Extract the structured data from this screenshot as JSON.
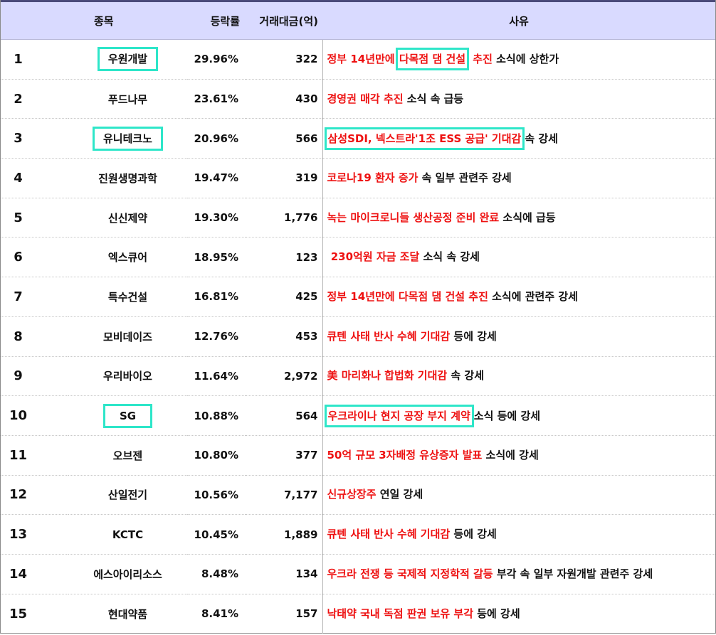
{
  "header": {
    "rank": "",
    "name": "종목",
    "rate": "등락률",
    "volume": "거래대금(억)",
    "reason": "사유"
  },
  "rows": [
    {
      "rank": "1",
      "name": "우원개발",
      "rate": "29.96%",
      "volume": "322",
      "reason": {
        "pre": "",
        "boxed": "",
        "hl": "정부 14년만에 다목점 댐 건설 추진",
        "plain": " 소식에 상한가"
      }
    },
    {
      "rank": "2",
      "name": "푸드나무",
      "rate": "23.61%",
      "volume": "430",
      "reason": {
        "hl": "경영권 매각 추진",
        "plain": " 소식 속 급등"
      }
    },
    {
      "rank": "3",
      "name": "유니테크노",
      "rate": "20.96%",
      "volume": "566",
      "reason": {
        "hl": "삼성SDI, 넥스트라'1조 ESS 공급' 기대감",
        "plain": "속 강세"
      }
    },
    {
      "rank": "4",
      "name": "진원생명과학",
      "rate": "19.47%",
      "volume": "319",
      "reason": {
        "hl": "코로나19 환자 증가",
        "plain": " 속 일부 관련주 강세"
      }
    },
    {
      "rank": "5",
      "name": "신신제약",
      "rate": "19.30%",
      "volume": "1,776",
      "reason": {
        "hl": "녹는 마이크로니들 생산공정 준비 완료",
        "plain": " 소식에 급등"
      }
    },
    {
      "rank": "6",
      "name": "엑스큐어",
      "rate": "18.95%",
      "volume": "123",
      "reason": {
        "hl": " 230억원 자금 조달",
        "plain": " 소식 속 강세"
      }
    },
    {
      "rank": "7",
      "name": "특수건설",
      "rate": "16.81%",
      "volume": "425",
      "reason": {
        "hl": "정부 14년만에 다목점 댐 건설 추진",
        "plain": " 소식에 관련주 강세"
      }
    },
    {
      "rank": "8",
      "name": "모비데이즈",
      "rate": "12.76%",
      "volume": "453",
      "reason": {
        "hl": "큐텐 사태 반사 수혜 기대감",
        "plain": " 등에 강세"
      }
    },
    {
      "rank": "9",
      "name": "우리바이오",
      "rate": "11.64%",
      "volume": "2,972",
      "reason": {
        "hl": "美 마리화나 합법화 기대감",
        "plain": " 속 강세"
      }
    },
    {
      "rank": "10",
      "name": "SG",
      "rate": "10.88%",
      "volume": "564",
      "reason": {
        "hl": "우크라이나 현지 공장 부지 계약",
        "plain": "소식 등에 강세"
      }
    },
    {
      "rank": "11",
      "name": "오브젠",
      "rate": "10.80%",
      "volume": "377",
      "reason": {
        "hl": "50억 규모 3자배정 유상증자 발표",
        "plain": " 소식에 강세"
      }
    },
    {
      "rank": "12",
      "name": "산일전기",
      "rate": "10.56%",
      "volume": "7,177",
      "reason": {
        "hl": "신규상장주",
        "plain": " 연일 강세"
      }
    },
    {
      "rank": "13",
      "name": "KCTC",
      "rate": "10.45%",
      "volume": "1,889",
      "reason": {
        "hl": "큐텐 사태 반사 수혜 기대감",
        "plain": " 등에 강세"
      }
    },
    {
      "rank": "14",
      "name": "에스아이리소스",
      "rate": "8.48%",
      "volume": "134",
      "reason": {
        "hl": "우크라 전쟁 등 국제적 지정학적 갈등",
        "plain": " 부각 속 일부 자원개발 관련주 강세"
      }
    },
    {
      "rank": "15",
      "name": "현대약품",
      "rate": "8.41%",
      "volume": "157",
      "reason": {
        "hl": "낙태약 국내 독점 판권 보유 부각",
        "plain": " 등에 강세"
      }
    }
  ],
  "row1_reason_parts": {
    "a": "정부 14년만에 ",
    "b": "다목점 댐 건설",
    "c": " 추진",
    "d": " 소식에 상한가"
  },
  "colors": {
    "header_bg": "#d9daff",
    "highlight_text": "#ee1111",
    "box_border": "#2ee6c9"
  }
}
